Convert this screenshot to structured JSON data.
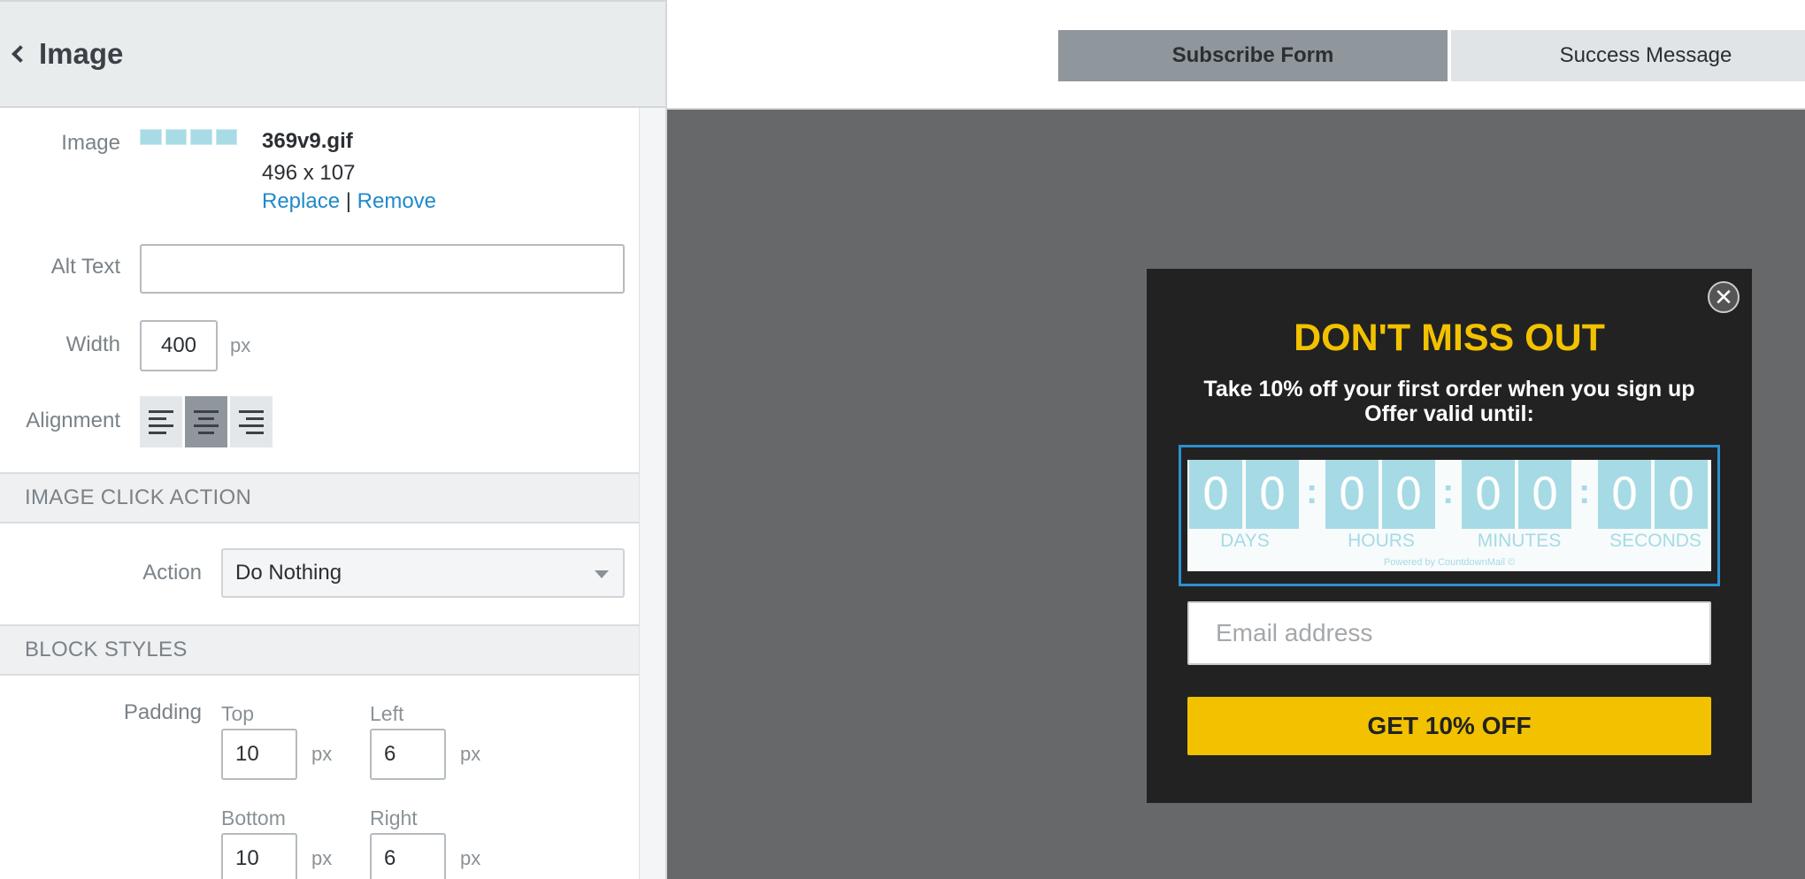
{
  "panel": {
    "title": "Image",
    "image_label": "Image",
    "file_name": "369v9.gif",
    "dimensions": "496 x 107",
    "replace_link": "Replace",
    "divider": "|",
    "remove_link": "Remove",
    "alt_text_label": "Alt Text",
    "alt_text_value": "",
    "width_label": "Width",
    "width_value": "400",
    "width_unit": "px",
    "alignment_label": "Alignment",
    "alignment_selected": "center",
    "click_action_section": "IMAGE CLICK ACTION",
    "action_label": "Action",
    "action_value": "Do Nothing",
    "block_styles_section": "BLOCK STYLES",
    "padding_label": "Padding",
    "padding": {
      "top_label": "Top",
      "top_value": "10",
      "left_label": "Left",
      "left_value": "6",
      "bottom_label": "Bottom",
      "bottom_value": "10",
      "right_label": "Right",
      "right_value": "6",
      "unit": "px"
    }
  },
  "tabs": {
    "subscribe": "Subscribe Form",
    "success": "Success Message"
  },
  "popup": {
    "close_glyph": "✕",
    "headline": "DON'T MISS OUT",
    "subline1": "Take 10% off your first order when you sign up",
    "subline2": "Offer valid until:",
    "timer": {
      "digits": [
        "0",
        "0",
        "0",
        "0",
        "0",
        "0",
        "0",
        "0"
      ],
      "colon": ":",
      "days": "DAYS",
      "hours": "HOURS",
      "minutes": "MINUTES",
      "seconds": "SECONDS",
      "powered": "Powered by CountdownMail ©"
    },
    "email_placeholder": "Email address",
    "cta": "GET 10% OFF"
  },
  "colors": {
    "accent_link": "#1f8ac9",
    "popup_bg": "#222222",
    "headline": "#f2c200",
    "cta_bg": "#f2c200",
    "timer_digit_bg": "#a6dae5",
    "canvas_bg": "#676869"
  },
  "icons": {
    "back": "chevron-left-icon",
    "close": "close-icon",
    "align_left": "align-left-icon",
    "align_center": "align-center-icon",
    "align_right": "align-right-icon",
    "dropdown": "caret-down-icon"
  }
}
